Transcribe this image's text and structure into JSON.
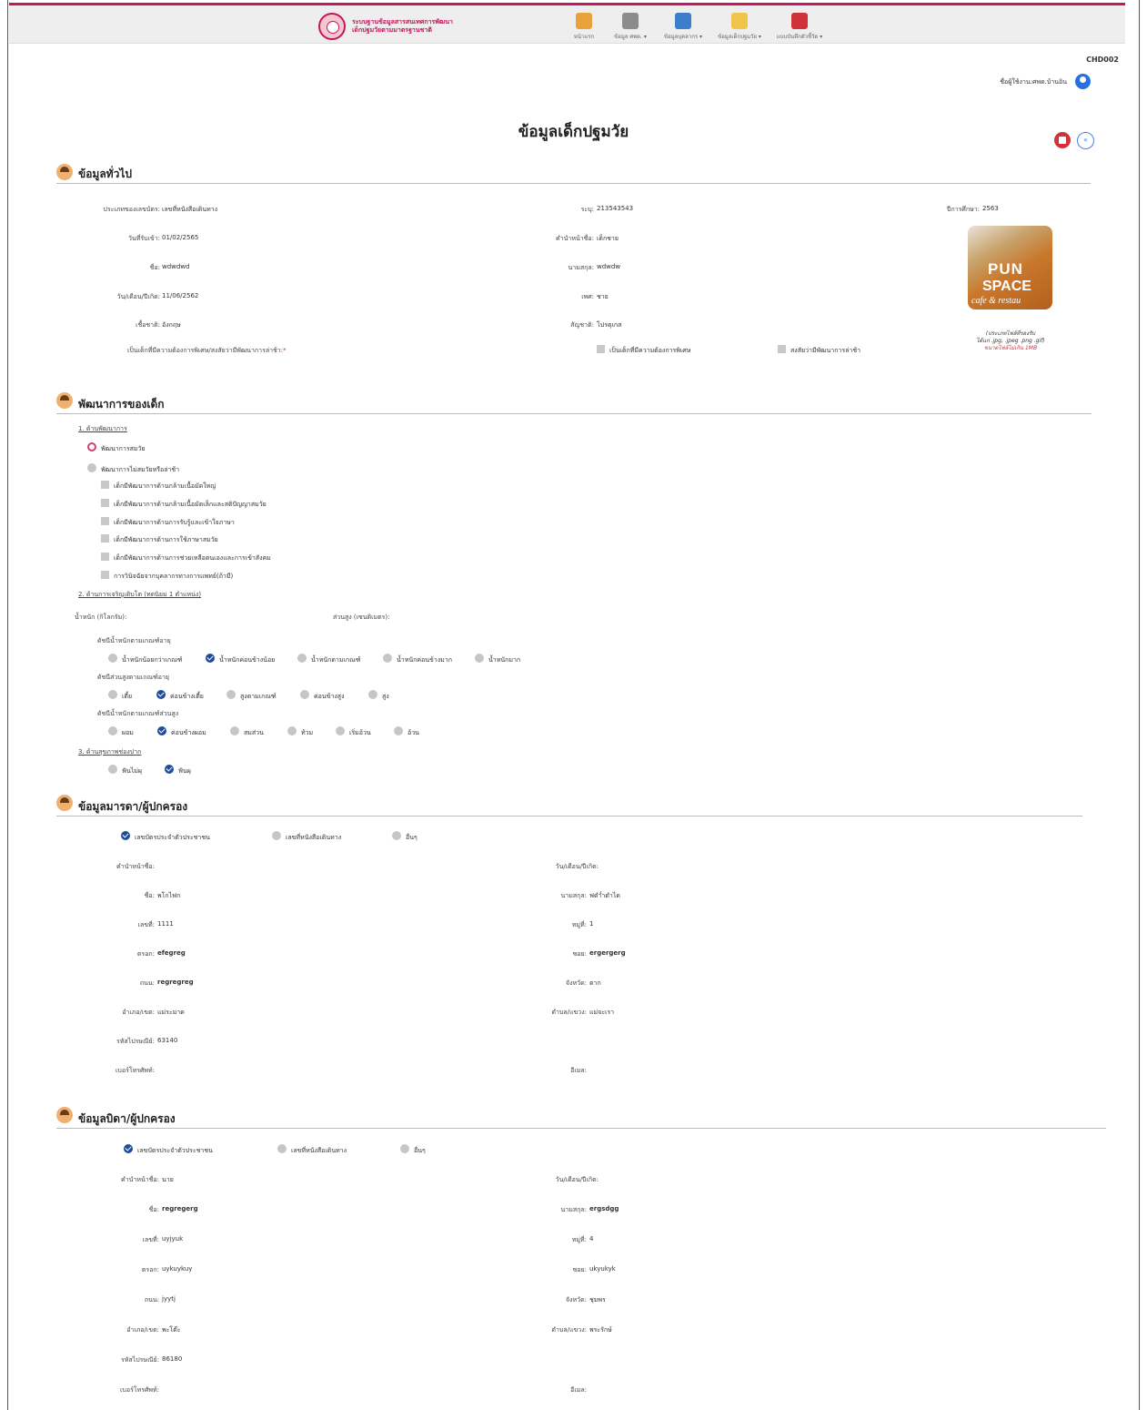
{
  "header": {
    "system_name_line1": "ระบบฐานข้อมูลสารสนเทศการพัฒนา",
    "system_name_line2": "เด็กปฐมวัยตามมาตรฐานชาติ",
    "nav": [
      {
        "label": "หน้าแรก",
        "icon": "home-icon",
        "color": "#e8a23a"
      },
      {
        "label": "ข้อมูล ศพด. ▾",
        "icon": "school-icon",
        "color": "#8c8c8c"
      },
      {
        "label": "ข้อมูลบุคลากร ▾",
        "icon": "people-search-icon",
        "color": "#3d7ecb"
      },
      {
        "label": "ข้อมูลเด็กปฐมวัย ▾",
        "icon": "child-folder-icon",
        "color": "#f0c34a"
      },
      {
        "label": "แบบบันทึกตัวชี้วัด ▾",
        "icon": "report-icon",
        "color": "#d0323a"
      }
    ]
  },
  "page_code": "CHD002",
  "user_label": "ชื่อผู้ใช้งาน:ศพด.บ้านอิน",
  "page_title": "ข้อมูลเด็กปฐมวัย",
  "general": {
    "title": "ข้อมูลทั่วไป",
    "id_type_label": "ประเภทของเลขบัตร:",
    "id_type_value": "เลขที่หนังสือเดินทาง",
    "specify_label": "ระบุ:",
    "specify_value": "213543543",
    "year_label": "ปีการศึกษา:",
    "year_value": "2563",
    "entry_label": "วันที่รับเข้า:",
    "entry_value": "01/02/2565",
    "prefix_label": "คำนำหน้าชื่อ:",
    "prefix_value": "เด็กชาย",
    "name_label": "ชื่อ:",
    "name_value": "wdwdwd",
    "surname_label": "นามสกุล:",
    "surname_value": "wdwdw",
    "dob_label": "วัน/เดือน/ปีเกิด:",
    "dob_value": "11/06/2562",
    "gender_label": "เพศ:",
    "gender_value": "ชาย",
    "ethnicity_label": "เชื้อชาติ:",
    "ethnicity_value": "อังกฤษ",
    "nationality_label": "สัญชาติ:",
    "nationality_value": "โปรตุเกส",
    "special_label": "เป็นเด็กที่มีความต้องการพิเศษ/สงสัยว่ามีพัฒนาการล่าช้า:",
    "special_req": "*",
    "special_opt1": "เป็นเด็กที่มีความต้องการพิเศษ",
    "special_opt2": "สงสัยว่ามีพัฒนาการล่าช้า",
    "photo_text1": "PUN",
    "photo_text2": "SPACE",
    "photo_text3": "cafe & restau",
    "photo_note1": "(ประเภทไฟล์ที่รองรับ",
    "photo_note2": "ได้แก่ .jpg, .jpeg .png .gif)",
    "photo_note3": "ขนาดไฟล์ไม่เกิน 1MB"
  },
  "development": {
    "title": "พัฒนาการของเด็ก",
    "sec1": "1. ด้านพัฒนาการ",
    "normal": "พัฒนาการสมวัย",
    "delayed": "พัฒนาการไม่สมวัยหรือล่าช้า",
    "items": [
      "เด็กมีพัฒนาการด้านกล้ามเนื้อมัดใหญ่",
      "เด็กมีพัฒนาการด้านกล้ามเนื้อมัดเล็กและสติปัญญาสมวัย",
      "เด็กมีพัฒนาการด้านการรับรู้และเข้าใจภาษา",
      "เด็กมีพัฒนาการด้านการใช้ภาษาสมวัย",
      "เด็กมีพัฒนาการด้านการช่วยเหลือตนเองและการเข้าสังคม",
      "การวินิจฉัยจากบุคลากรทางการแพทย์(ถ้ามี)"
    ],
    "sec2": "2. ด้านการเจริญเติบโต (ทดนิยม 1 ตำแหน่ง)",
    "weight_label": "น้ำหนัก (กิโลกรัม):",
    "height_label": "ส่วนสูง (เซนติเมตร):",
    "wfa_label": "ดัชนีน้ำหนักตามเกณฑ์อายุ",
    "wfa": [
      "น้ำหนักน้อยกว่าเกณฑ์",
      "น้ำหนักค่อนข้างน้อย",
      "น้ำหนักตามเกณฑ์",
      "น้ำหนักค่อนข้างมาก",
      "น้ำหนักมาก"
    ],
    "hfa_label": "ดัชนีส่วนสูงตามเกณฑ์อายุ",
    "hfa": [
      "เตี้ย",
      "ค่อนข้างเตี้ย",
      "สูงตามเกณฑ์",
      "ค่อนข้างสูง",
      "สูง"
    ],
    "wfh_label": "ดัชนีน้ำหนักตามเกณฑ์ส่วนสูง",
    "wfh": [
      "ผอม",
      "ค่อนข้างผอม",
      "สมส่วน",
      "ท้วม",
      "เริ่มอ้วน",
      "อ้วน"
    ],
    "sec3": "3. ด้านสุขภาพช่องปาก",
    "oral": [
      "ฟันไม่ผุ",
      "ฟันผุ"
    ]
  },
  "mother": {
    "title": "ข้อมูลมารดา/ผู้ปกครอง",
    "id_opts": [
      "เลขบัตรประจำตัวประชาชน",
      "เลขที่หนังสือเดินทาง",
      "อื่นๆ"
    ],
    "prefix_label": "คำนำหน้าชื่อ:",
    "prefix_value": "",
    "dob_label": "วัน/เดือน/ปีเกิด:",
    "dob_value": "",
    "name_label": "ชื่อ:",
    "name_value": "พโกไฟก",
    "surname_label": "นามสกุล:",
    "surname_value": "ฟดำ่ำดำได",
    "houseno_label": "เลขที่:",
    "houseno_value": "1111",
    "moo_label": "หมู่ที่:",
    "moo_value": "1",
    "alley_label": "ตรอก:",
    "alley_value": "efegreg",
    "soi_label": "ซอย:",
    "soi_value": "ergergerg",
    "road_label": "ถนน:",
    "road_value": "regregreg",
    "province_label": "จังหวัด:",
    "province_value": "ตาก",
    "district_label": "อำเภอ/เขต:",
    "district_value": "แม่ระมาด",
    "subdistrict_label": "ตำบล/แขวง:",
    "subdistrict_value": "แม่จะเรา",
    "postal_label": "รหัสไปรษณีย์:",
    "postal_value": "63140",
    "phone_label": "เบอร์โทรศัพท์:",
    "phone_value": "",
    "email_label": "อีเมล:",
    "email_value": ""
  },
  "father": {
    "title": "ข้อมูลบิดา/ผู้ปกครอง",
    "id_opts": [
      "เลขบัตรประจำตัวประชาชน",
      "เลขที่หนังสือเดินทาง",
      "อื่นๆ"
    ],
    "prefix_label": "คำนำหน้าชื่อ:",
    "prefix_value": "นาย",
    "dob_label": "วัน/เดือน/ปีเกิด:",
    "dob_value": "",
    "name_label": "ชื่อ:",
    "name_value": "regregerg",
    "surname_label": "นามสกุล:",
    "surname_value": "ergsdgg",
    "houseno_label": "เลขที่:",
    "houseno_value": "uyjyuk",
    "moo_label": "หมู่ที่:",
    "moo_value": "4",
    "alley_label": "ตรอก:",
    "alley_value": "uykuykuy",
    "soi_label": "ซอย:",
    "soi_value": "ukyukyk",
    "road_label": "ถนน:",
    "road_value": "jyytj",
    "province_label": "จังหวัด:",
    "province_value": "ชุมพร",
    "district_label": "อำเภอ/เขต:",
    "district_value": "พะโต๊ะ",
    "subdistrict_label": "ตำบล/แขวง:",
    "subdistrict_value": "พระรักษ์",
    "postal_label": "รหัสไปรษณีย์:",
    "postal_value": "86180",
    "phone_label": "เบอร์โทรศัพท์:",
    "phone_value": "",
    "email_label": "อีเมล:",
    "email_value": ""
  }
}
